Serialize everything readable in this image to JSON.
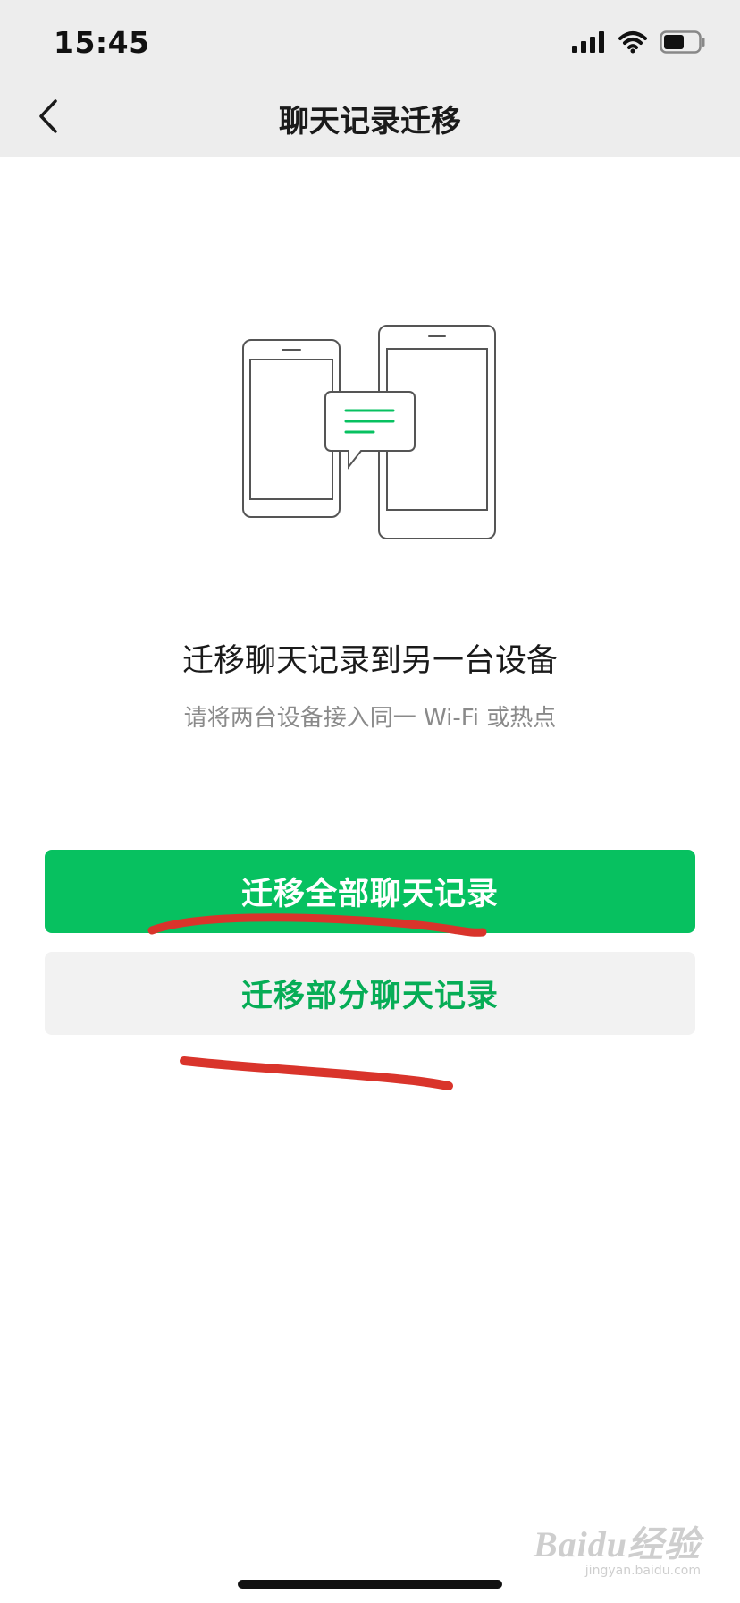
{
  "status_bar": {
    "time": "15:45",
    "icons": [
      "signal-icon",
      "wifi-icon",
      "battery-icon"
    ]
  },
  "nav": {
    "back_icon": "chevron-left-icon",
    "title": "聊天记录迁移"
  },
  "illustration": {
    "icon": "phone-to-phone-transfer-icon",
    "accent_color": "#07c160"
  },
  "content": {
    "headline": "迁移聊天记录到另一台设备",
    "subline": "请将两台设备接入同一 Wi-Fi 或热点"
  },
  "buttons": {
    "migrate_all": "迁移全部聊天记录",
    "migrate_partial": "迁移部分聊天记录"
  },
  "colors": {
    "brand_green": "#07c160",
    "secondary_text_green": "#06ad56",
    "annotation_red": "#d9342b"
  },
  "watermark": {
    "brand": "Baidu经验",
    "url": "jingyan.baidu.com"
  }
}
